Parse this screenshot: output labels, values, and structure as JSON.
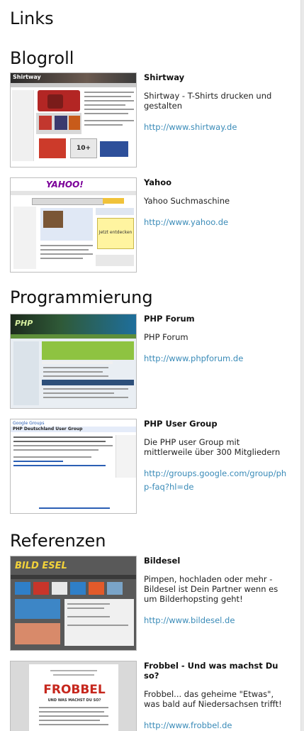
{
  "page": {
    "title": "Links"
  },
  "categories": [
    {
      "name": "Blogroll",
      "links": [
        {
          "title": "Shirtway",
          "description": "Shirtway - T-Shirts drucken und gestalten",
          "url": "http://www.shirtway.de"
        },
        {
          "title": "Yahoo",
          "description": "Yahoo Suchmaschine",
          "url": "http://www.yahoo.de"
        }
      ]
    },
    {
      "name": "Programmierung",
      "links": [
        {
          "title": "PHP Forum",
          "description": "PHP Forum",
          "url": "http://www.phpforum.de"
        },
        {
          "title": "PHP User Group",
          "description": "Die PHP user Group mit mittlerweile über 300 Mitgliedern",
          "url": "http://groups.google.com/group/php-faq?hl=de"
        }
      ]
    },
    {
      "name": "Referenzen",
      "links": [
        {
          "title": "Bildesel",
          "description": "Pimpen, hochladen oder mehr - Bildesel ist Dein Partner wenn es um Bilderhopsting geht!",
          "url": "http://www.bildesel.de"
        },
        {
          "title": "Frobbel - Und was machst Du so?",
          "description": "Frobbel... das geheime \"Etwas\", was bald auf Niedersachsen trifft!",
          "url": "http://www.frobbel.de"
        }
      ]
    }
  ],
  "thumbnails": {
    "shirtway": {
      "logo_text": "Shirtway",
      "badge_text": "10+"
    },
    "yahoo": {
      "logo_text": "YAHOO!",
      "ad_text": "Jetzt entdecken"
    },
    "phpforum": {
      "logo_text": "PHP"
    },
    "phpusergroup": {
      "logo_text": "Google Groups",
      "heading_text": "PHP Deutschland User Group"
    },
    "bildesel": {
      "logo_text": "BILD ESEL"
    },
    "frobbel": {
      "logo_text": "FROBBEL",
      "tagline_text": "UND WAS MACHST DU SO?"
    }
  },
  "colors": {
    "link": "#3a8bb8",
    "heading": "#111111"
  }
}
